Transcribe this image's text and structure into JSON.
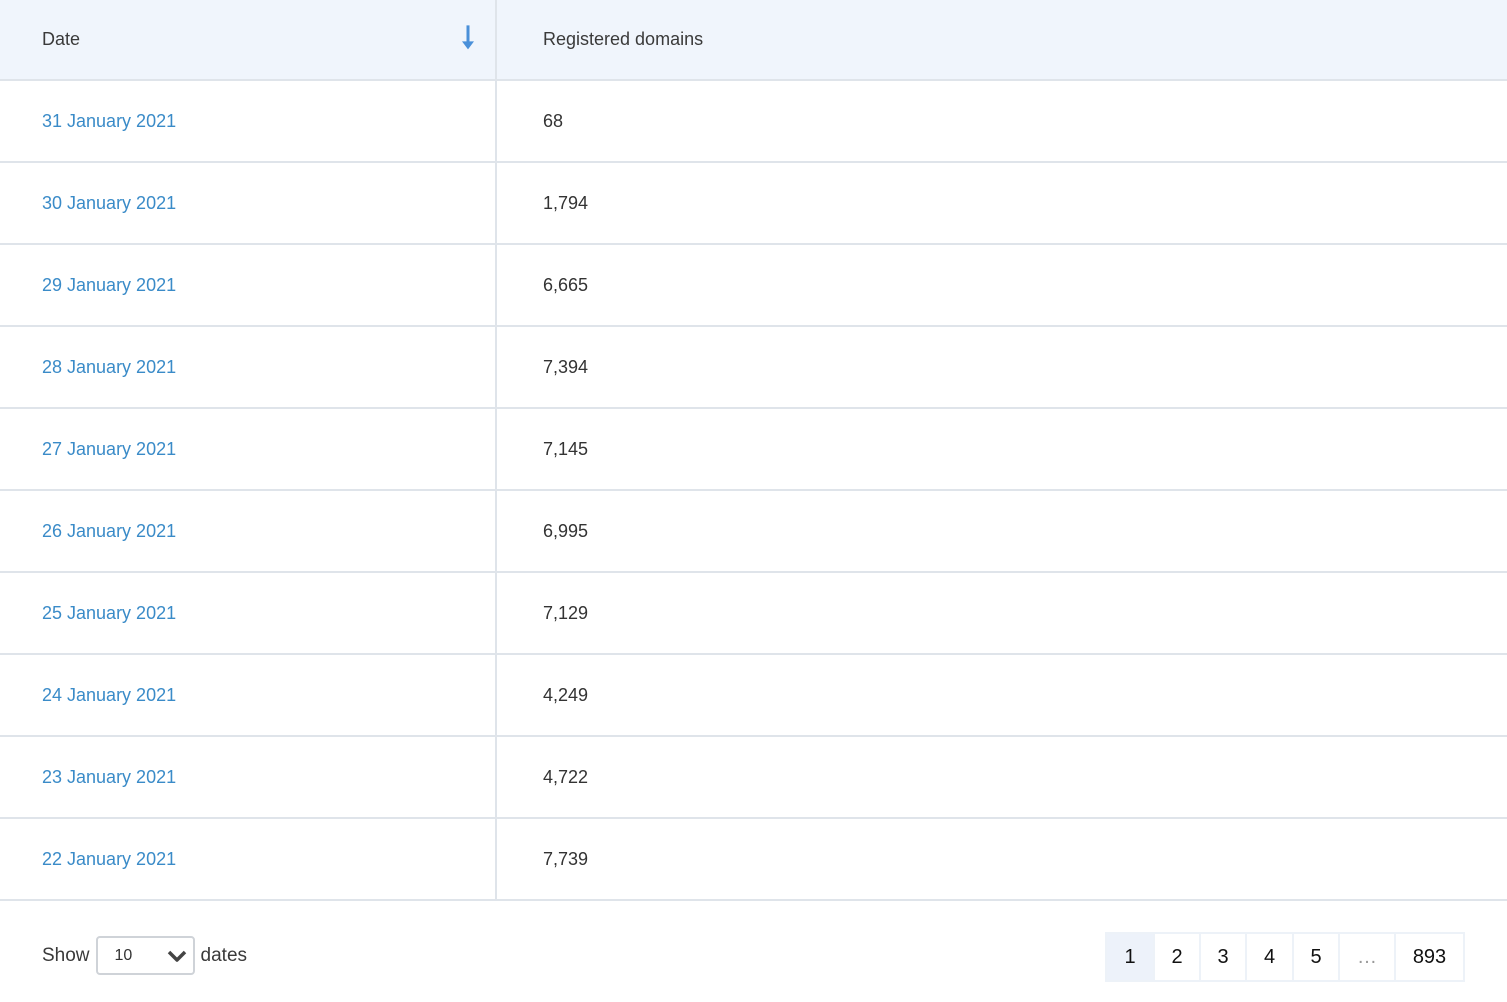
{
  "table": {
    "columns": {
      "date": "Date",
      "registered": "Registered domains"
    },
    "sort": {
      "column": "date",
      "direction": "descending",
      "icon": "arrow-down-icon"
    },
    "rows": [
      {
        "date": "31 January 2021",
        "count": "68"
      },
      {
        "date": "30 January 2021",
        "count": "1,794"
      },
      {
        "date": "29 January 2021",
        "count": "6,665"
      },
      {
        "date": "28 January 2021",
        "count": "7,394"
      },
      {
        "date": "27 January 2021",
        "count": "7,145"
      },
      {
        "date": "26 January 2021",
        "count": "6,995"
      },
      {
        "date": "25 January 2021",
        "count": "7,129"
      },
      {
        "date": "24 January 2021",
        "count": "4,249"
      },
      {
        "date": "23 January 2021",
        "count": "4,722"
      },
      {
        "date": "22 January 2021",
        "count": "7,739"
      }
    ]
  },
  "footer": {
    "show_label": "Show",
    "page_size": "10",
    "unit_label": "dates",
    "pagination": {
      "current": "1",
      "pages": [
        "1",
        "2",
        "3",
        "4",
        "5",
        "…",
        "893"
      ]
    }
  },
  "colors": {
    "link": "#3a8bc8",
    "header_bg": "#f0f5fc",
    "border": "#dfe4ea",
    "sort_icon": "#4a90d9"
  }
}
